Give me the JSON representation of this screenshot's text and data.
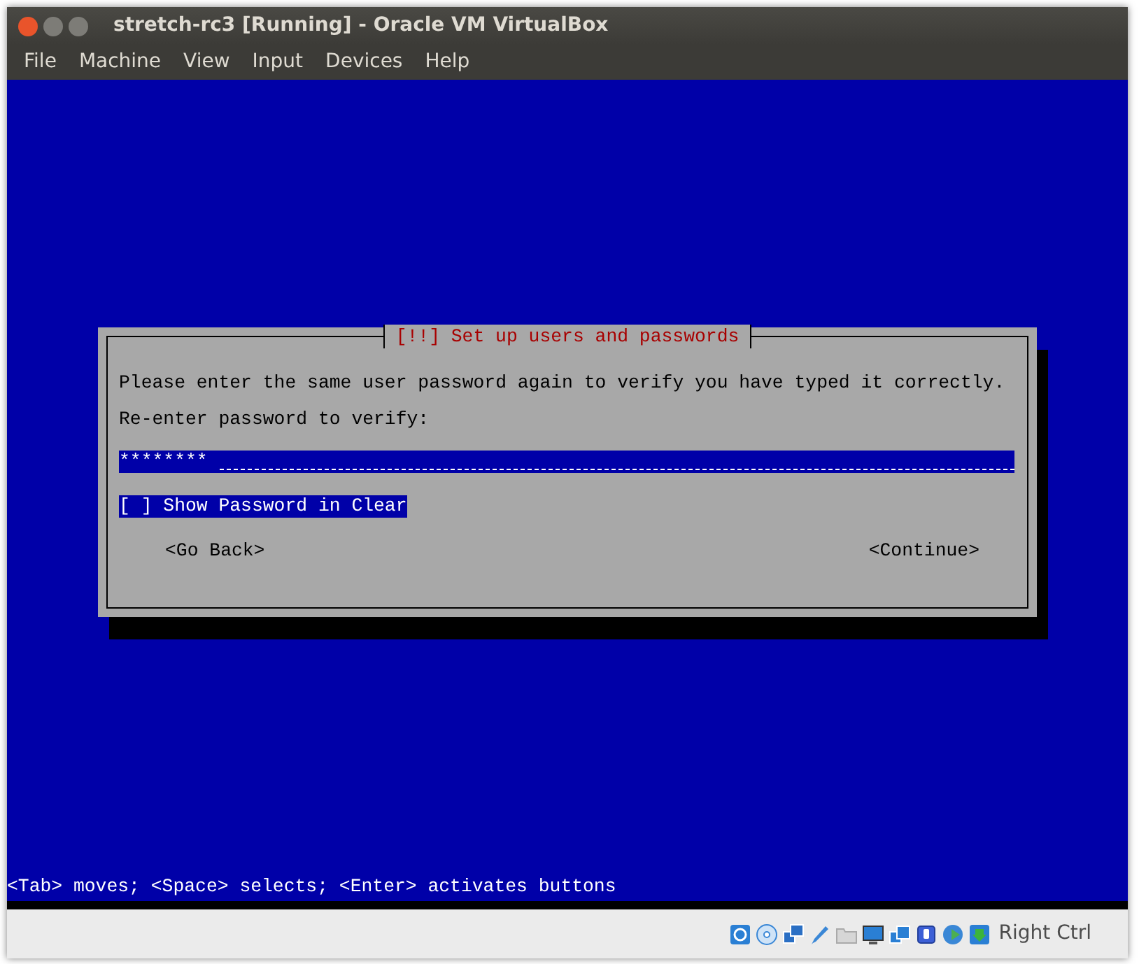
{
  "window": {
    "title": "stretch-rc3 [Running] - Oracle VM VirtualBox"
  },
  "menu": [
    "File",
    "Machine",
    "View",
    "Input",
    "Devices",
    "Help"
  ],
  "dialog": {
    "title": "[!!] Set up users and passwords",
    "message": "Please enter the same user password again to verify you have typed it correctly.",
    "prompt": "Re-enter password to verify:",
    "password": {
      "value": "********",
      "focused": true
    },
    "checkbox": {
      "mark": "[ ]",
      "label": "Show Password in Clear",
      "focused": true
    },
    "buttons": [
      {
        "label": "<Go Back>",
        "focused": false
      },
      {
        "label": "<Continue>",
        "focused": false
      }
    ]
  },
  "hint": "<Tab> moves; <Space> selects; <Enter> activates buttons",
  "status_bar": {
    "host_key": "Right Ctrl"
  }
}
